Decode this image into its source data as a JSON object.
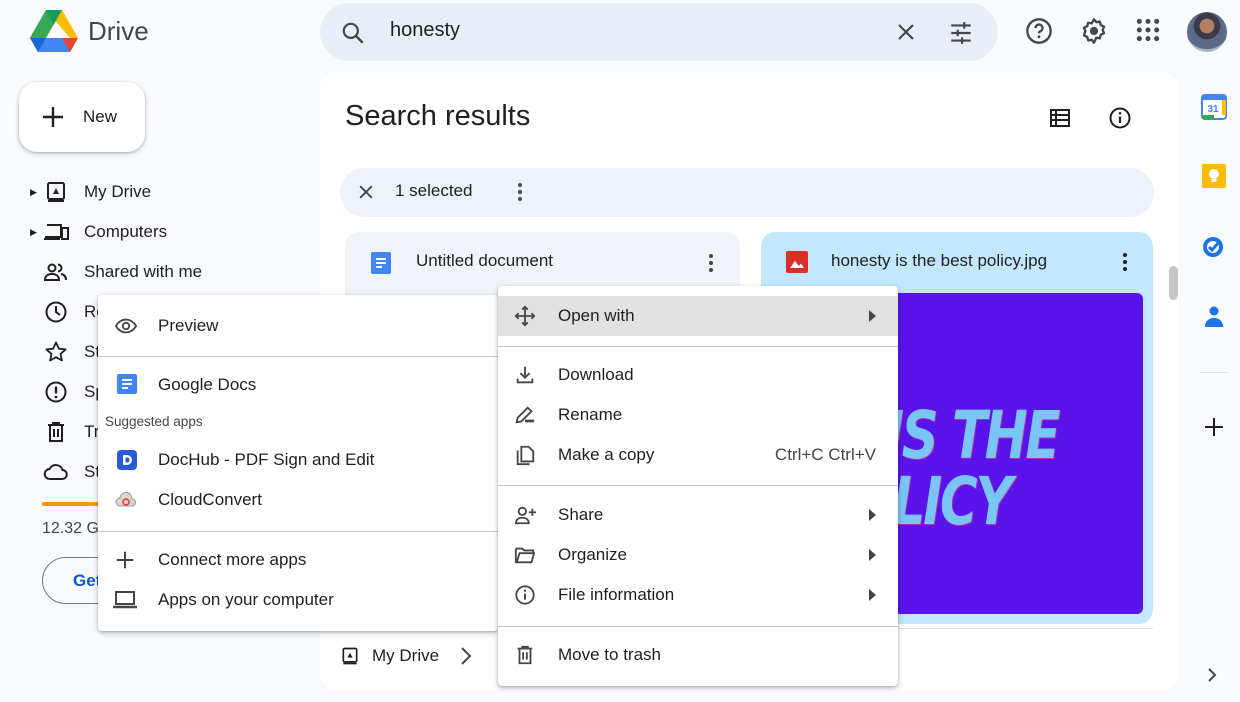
{
  "app": {
    "name": "Drive"
  },
  "search": {
    "query": "honesty",
    "clear_label": "Clear search",
    "options_label": "Search options"
  },
  "header_icons": [
    "help-icon",
    "settings-icon",
    "apps-grid-icon"
  ],
  "new_button": {
    "label": "New"
  },
  "sidebar": {
    "items": [
      {
        "label": "My Drive",
        "icon": "my-drive-icon",
        "expandable": true
      },
      {
        "label": "Computers",
        "icon": "computers-icon",
        "expandable": true
      },
      {
        "label": "Shared with me",
        "icon": "shared-icon",
        "expandable": false
      },
      {
        "label": "Re",
        "icon": "recent-icon",
        "expandable": false
      },
      {
        "label": "St",
        "icon": "star-icon",
        "expandable": false
      },
      {
        "label": "Sp",
        "icon": "spam-icon",
        "expandable": false
      },
      {
        "label": "Tr",
        "icon": "trash-icon",
        "expandable": false
      },
      {
        "label": "St",
        "icon": "cloud-icon",
        "expandable": false
      }
    ],
    "storage": {
      "text": "12.32 G",
      "used_fraction": 0.82,
      "color": "#f29900"
    },
    "get_storage_label": "Get"
  },
  "main": {
    "title": "Search results",
    "selection": {
      "count_label": "1 selected"
    },
    "files": [
      {
        "name": "Untitled document",
        "type": "doc",
        "selected": false
      },
      {
        "name": "honesty is the best policy.jpg",
        "type": "image",
        "selected": true,
        "thumb_line1": "HONESTY IS THE",
        "thumb_line2": "BEST POLICY"
      }
    ],
    "location": {
      "label": "My Drive"
    }
  },
  "context_menu": {
    "items": [
      {
        "label": "Open with",
        "icon": "open-with-icon",
        "submenu": true,
        "highlighted": true
      },
      {
        "label": "Download",
        "icon": "download-icon"
      },
      {
        "label": "Rename",
        "icon": "rename-icon"
      },
      {
        "label": "Make a copy",
        "icon": "copy-icon",
        "shortcut": "Ctrl+C Ctrl+V"
      },
      {
        "label": "Share",
        "icon": "share-icon",
        "submenu": true
      },
      {
        "label": "Organize",
        "icon": "organize-icon",
        "submenu": true
      },
      {
        "label": "File information",
        "icon": "info-icon",
        "submenu": true
      },
      {
        "label": "Move to trash",
        "icon": "trash-icon"
      }
    ]
  },
  "open_with_menu": {
    "preview": "Preview",
    "default_app": "Google Docs",
    "suggested_header": "Suggested apps",
    "suggested": [
      "DocHub - PDF Sign and Edit",
      "CloudConvert"
    ],
    "connect_more": "Connect more apps",
    "apps_on_computer": "Apps on your computer"
  },
  "right_rail": [
    "calendar-icon",
    "keep-icon",
    "tasks-icon",
    "contacts-icon",
    "add-addon-icon"
  ],
  "right_rail_calendar_day": "31",
  "colors": {
    "accent": "#0b57d0",
    "selected_card": "#c2e7ff",
    "thumb_bg": "#5a13ea",
    "thumb_text": "#79c6f6"
  }
}
